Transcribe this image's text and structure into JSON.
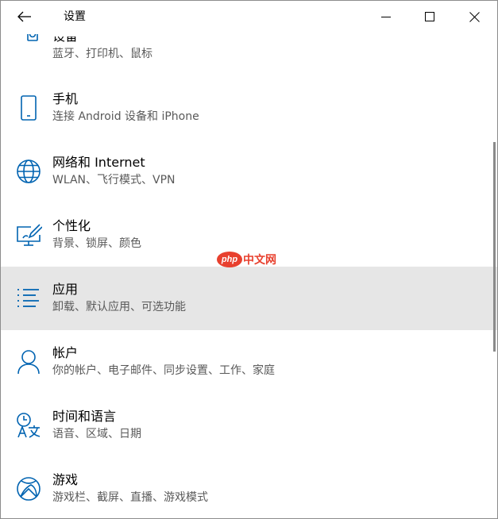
{
  "titlebar": {
    "title": "设置"
  },
  "items": [
    {
      "label": "设备",
      "desc": "蓝牙、打印机、鼠标",
      "icon": "keyboard-speaker-icon"
    },
    {
      "label": "手机",
      "desc": "连接 Android 设备和 iPhone",
      "icon": "phone-icon"
    },
    {
      "label": "网络和 Internet",
      "desc": "WLAN、飞行模式、VPN",
      "icon": "globe-icon"
    },
    {
      "label": "个性化",
      "desc": "背景、锁屏、颜色",
      "icon": "brush-monitor-icon"
    },
    {
      "label": "应用",
      "desc": "卸载、默认应用、可选功能",
      "icon": "list-icon"
    },
    {
      "label": "帐户",
      "desc": "你的帐户、电子邮件、同步设置、工作、家庭",
      "icon": "person-icon"
    },
    {
      "label": "时间和语言",
      "desc": "语音、区域、日期",
      "icon": "clock-language-icon"
    },
    {
      "label": "游戏",
      "desc": "游戏栏、截屏、直播、游戏模式",
      "icon": "xbox-icon"
    }
  ],
  "watermark": {
    "logo": "php",
    "text": "中文网"
  },
  "colors": {
    "accent": "#0063b1",
    "selected_bg": "#e6e6e6",
    "desc_text": "#595959"
  }
}
